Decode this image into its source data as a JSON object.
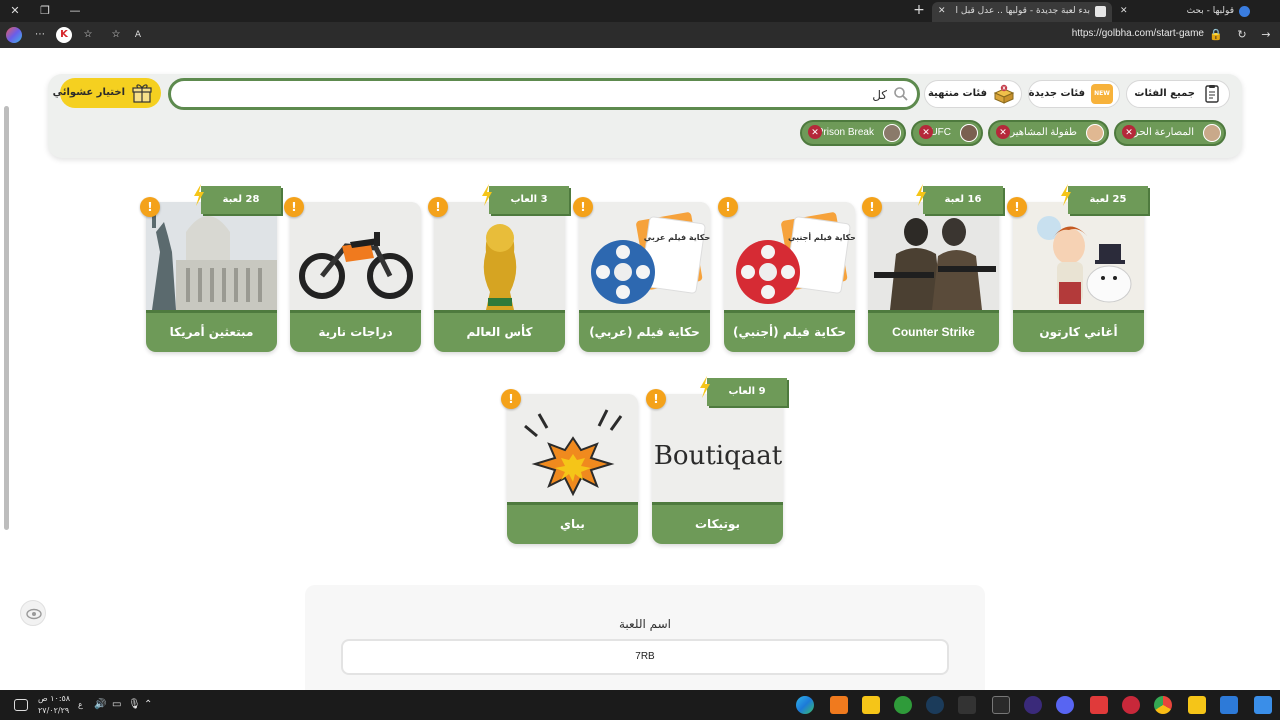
{
  "browser": {
    "tabs": [
      {
        "title": "بدء لعبة جديدة - قولبها .. عدل قبل ا",
        "active": true
      },
      {
        "title": "قولبها - بحث",
        "active": false
      }
    ],
    "url": "https://golbha.com/start-game",
    "zoom_hint": "A"
  },
  "filters": {
    "all_categories": "جميع الفئات",
    "new_categories": "فئات جديدة",
    "new_badge": "NEW",
    "finished_categories": "فئات منتهية",
    "search_value": "كل",
    "random_button": "اختيار عشوائي",
    "selected_chips": [
      {
        "label": "المصارعة الحرة"
      },
      {
        "label": "طفولة المشاهير"
      },
      {
        "label": "UFC"
      },
      {
        "label": "Prison Break"
      }
    ]
  },
  "categories": [
    {
      "name": "أغاني كارتون",
      "badge": "25 لعبة",
      "image": "cartoon-art"
    },
    {
      "name": "Counter Strike",
      "badge": "16 لعبة",
      "image": "soldiers"
    },
    {
      "name": "حكاية فيلم (أجنبي)",
      "badge": "",
      "image": "film-reel-red",
      "image_caption": "حكاية فيلم أجنبي"
    },
    {
      "name": "حكاية فيلم (عربي)",
      "badge": "",
      "image": "film-reel-blue",
      "image_caption": "حكاية فيلم عربي"
    },
    {
      "name": "كأس العالم",
      "badge": "3 العاب",
      "image": "world-cup-trophy"
    },
    {
      "name": "دراجات نارية",
      "badge": "",
      "image": "motorcycle"
    },
    {
      "name": "مبتعثين أمريكا",
      "badge": "28 لعبة",
      "image": "capitol-statue"
    },
    {
      "name": "بوتيكات",
      "badge": "9 العاب",
      "image": "boutiqaat-logo",
      "image_caption": "Boutiqaat"
    },
    {
      "name": "بباي",
      "badge": "",
      "image": "explosion"
    }
  ],
  "warning_symbol": "!",
  "game_form": {
    "label": "اسم اللعبة",
    "value": "7RB"
  },
  "taskbar": {
    "time": "١٠:٥٨ ص",
    "date": "٢٧/٠٢/٢٩",
    "lang": "ع"
  },
  "colors": {
    "brand_green": "#6e9a58",
    "brand_green_dark": "#4e7a3e",
    "accent_yellow": "#f5d020",
    "warning_orange": "#f4a21a",
    "chip_close_red": "#b5283a"
  }
}
